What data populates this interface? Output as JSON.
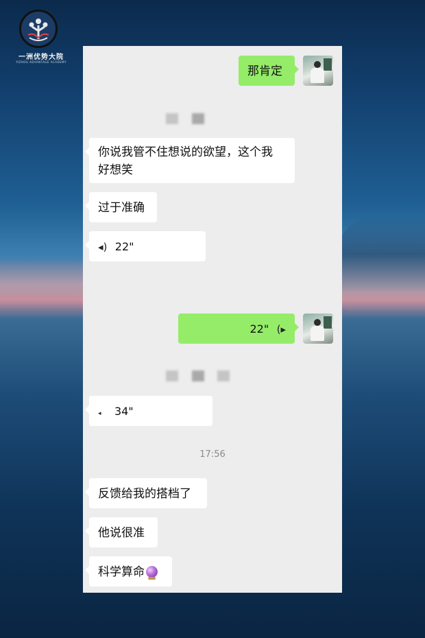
{
  "logo": {
    "title": "一洲优势大院",
    "subtitle": "YIZHOU ADVANTAGE ACADEMY"
  },
  "messages": [
    {
      "side": "right",
      "text": "那肯定"
    },
    {
      "side": "left",
      "text_line1": "你说我管不住想说的欲望，这个我",
      "text_line2": "好想笑"
    },
    {
      "side": "left",
      "text": "过于准确"
    },
    {
      "side": "left",
      "type": "voice",
      "duration": "22\""
    },
    {
      "side": "right",
      "type": "voice",
      "duration": "22\""
    },
    {
      "side": "left",
      "type": "voice",
      "duration": "34\""
    },
    {
      "side": "left",
      "text": "反馈给我的搭档了"
    },
    {
      "side": "left",
      "text": "他说很准"
    },
    {
      "side": "left",
      "text": "科学算命"
    }
  ],
  "timestamp": "17:56",
  "colors": {
    "my_bubble": "#95ec69",
    "their_bubble": "#ffffff",
    "chat_bg": "#ededed"
  },
  "icons": {
    "voice": "voice-wave-icon",
    "emoji": "crystal-ball-icon"
  }
}
